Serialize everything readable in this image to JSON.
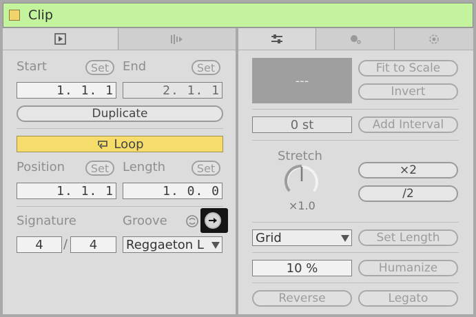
{
  "title": "Clip",
  "colors": {
    "title_bar": "#c3f39d",
    "clip_square": "#f2d26b",
    "loop_active": "#f6dc6a"
  },
  "tabs_left": [
    {
      "icon": "play-clip-icon"
    },
    {
      "icon": "sample-waveform-icon"
    }
  ],
  "tabs_right": [
    {
      "icon": "sliders-icon"
    },
    {
      "icon": "envelopes-icon"
    },
    {
      "icon": "launch-icon"
    }
  ],
  "left": {
    "start_label": "Start",
    "end_label": "End",
    "set_label": "Set",
    "start_value": "1.  1.  1",
    "end_value": "2.  1.  1",
    "duplicate_label": "Duplicate",
    "loop_label": "Loop",
    "position_label": "Position",
    "length_label": "Length",
    "position_value": "1.  1.  1",
    "length_value": "1.  0.  0",
    "signature_label": "Signature",
    "groove_label": "Groove",
    "sig_num": "4",
    "sig_slash": "/",
    "sig_den": "4",
    "groove_value": "Reggaeton L"
  },
  "right": {
    "pitch_display": "---",
    "fit_to_scale": "Fit to Scale",
    "invert": "Invert",
    "transpose_value": "0 st",
    "add_interval": "Add Interval",
    "stretch_label": "Stretch",
    "stretch_value": "×1.0",
    "times2": "×2",
    "div2": "/2",
    "grid_value": "Grid",
    "set_length": "Set Length",
    "humanize_value": "10 %",
    "humanize": "Humanize",
    "reverse": "Reverse",
    "legato": "Legato"
  }
}
